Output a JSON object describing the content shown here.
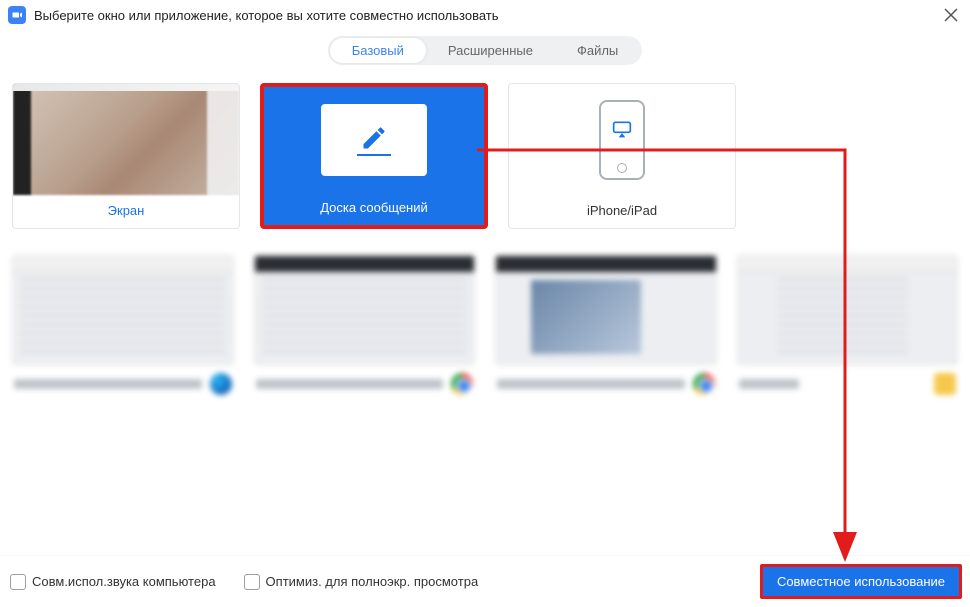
{
  "header": {
    "title": "Выберите окно или приложение, которое вы хотите совместно использовать"
  },
  "tabs": {
    "basic": "Базовый",
    "advanced": "Расширенные",
    "files": "Файлы"
  },
  "options": {
    "screen": "Экран",
    "whiteboard": "Доска сообщений",
    "iphone_ipad": "iPhone/iPad"
  },
  "footer": {
    "share_audio": "Совм.испол.звука компьютера",
    "optimize_fullscreen": "Оптимиз. для полноэкр. просмотра",
    "share_button": "Совместное использование"
  },
  "colors": {
    "accent": "#1a73e8",
    "annotation": "#e21b1b"
  }
}
